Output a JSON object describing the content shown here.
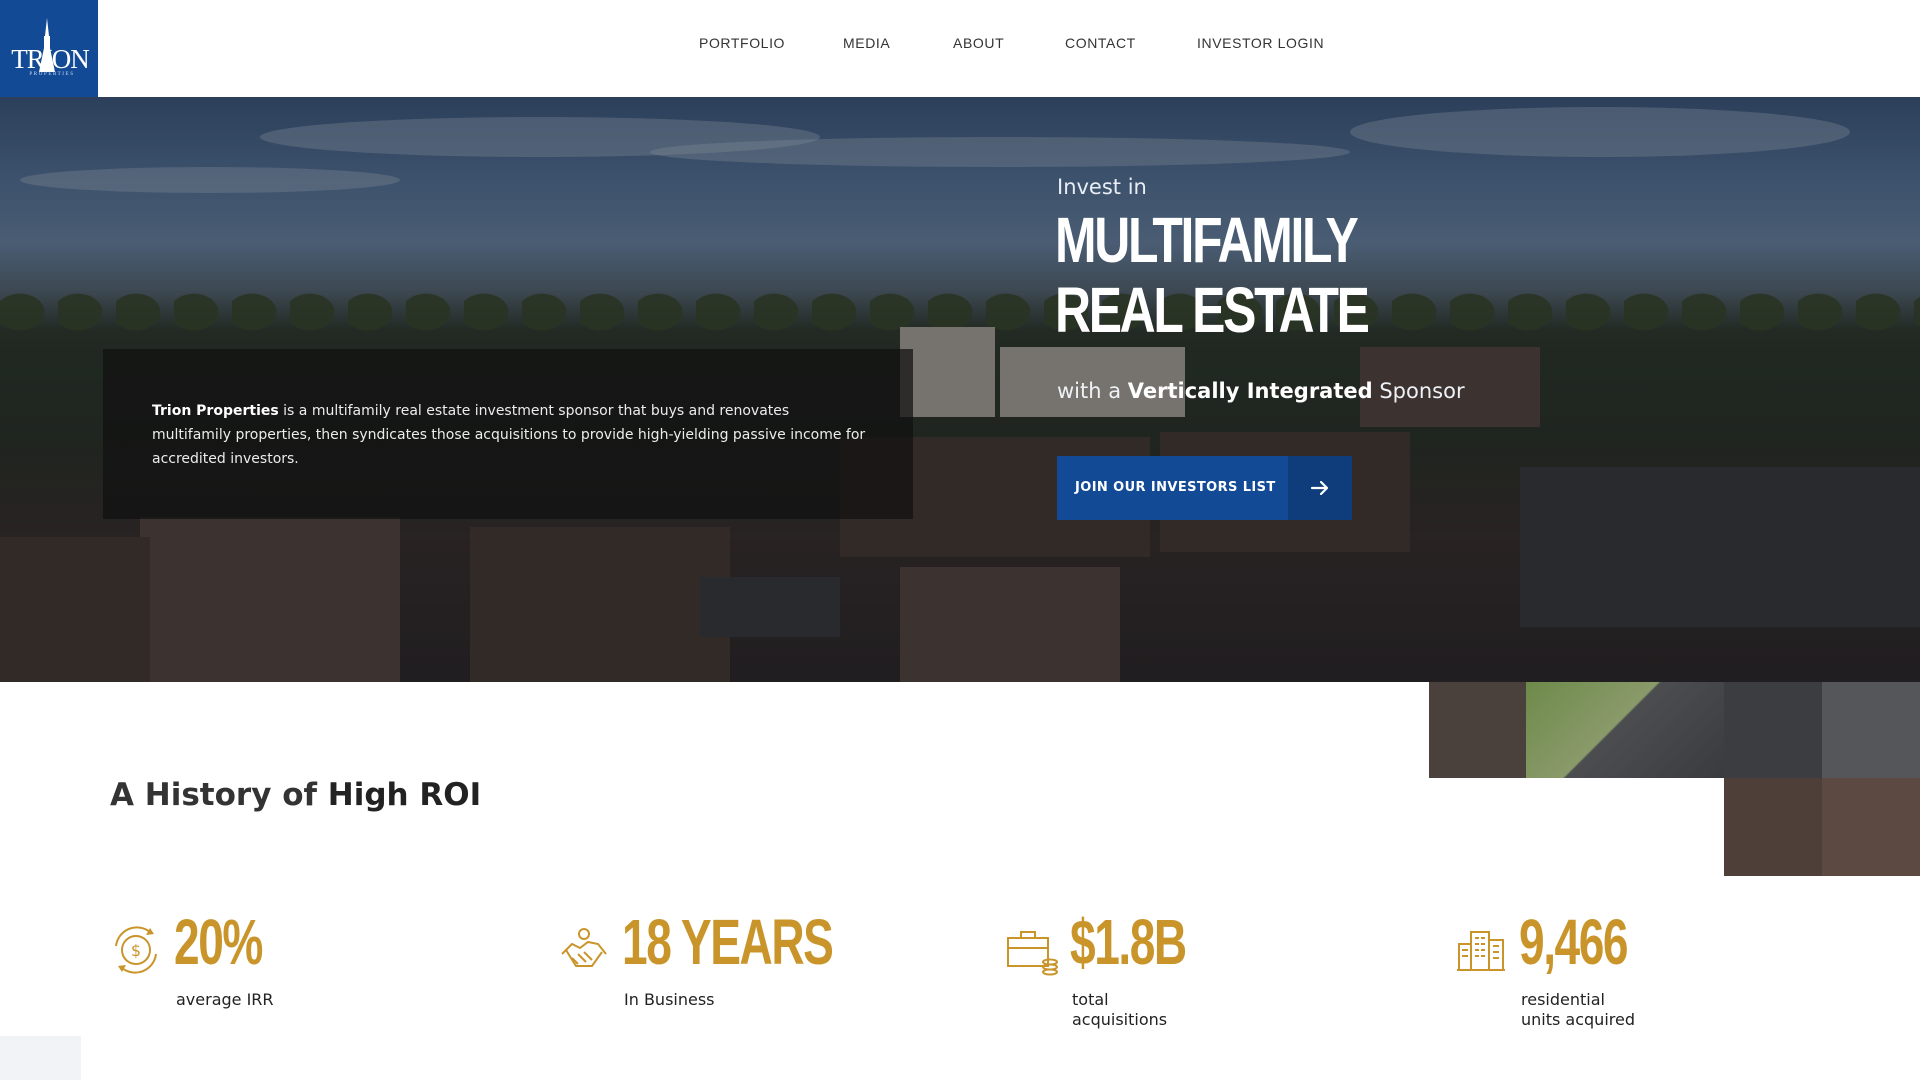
{
  "brand": {
    "logo_text": "TRION",
    "logo_sub": "PROPERTIES",
    "color": "#134a95"
  },
  "nav": {
    "items": [
      {
        "label": "PORTFOLIO"
      },
      {
        "label": "MEDIA"
      },
      {
        "label": "ABOUT"
      },
      {
        "label": "CONTACT"
      },
      {
        "label": "INVESTOR LOGIN"
      }
    ]
  },
  "hero": {
    "description_bold": "Trion Properties",
    "description_rest": " is a multifamily real estate investment sponsor that buys and renovates multifamily properties, then syndicates those acquisitions to provide high-yielding passive income for accredited investors.",
    "invest_in": "Invest in",
    "headline_line1": "MULTIFAMILY",
    "headline_line2": "REAL ESTATE",
    "sub_prefix": "with a ",
    "sub_bold": "Vertically Integrated",
    "sub_suffix": " Sponsor",
    "cta_label": "JOIN OUR INVESTORS LIST",
    "cta_icon": "arrow-right-icon"
  },
  "history": {
    "title_prefix": "A History of ",
    "title_bold": "High ROI",
    "accent": "#c9952b",
    "stats": [
      {
        "value": "20%",
        "label": "average IRR",
        "icon": "dollar-cycle-icon"
      },
      {
        "value": "18 YEARS",
        "label": "In Business",
        "icon": "handshake-icon"
      },
      {
        "value": "$1.8B",
        "label": "total\nacquisitions",
        "icon": "briefcase-coins-icon"
      },
      {
        "value": "9,466",
        "label": "residential\nunits acquired",
        "icon": "buildings-icon"
      }
    ]
  }
}
